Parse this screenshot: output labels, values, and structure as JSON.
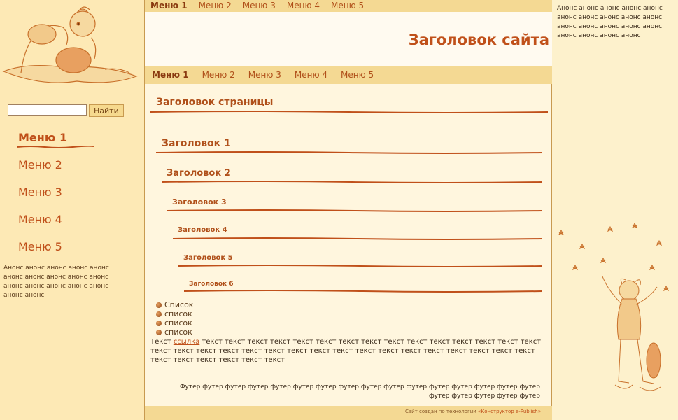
{
  "top_nav": [
    "Меню 1",
    "Меню 2",
    "Меню 3",
    "Меню 4",
    "Меню 5"
  ],
  "mid_nav": [
    "Меню 1",
    "Меню 2",
    "Меню 3",
    "Меню 4",
    "Меню 5"
  ],
  "site_title": "Заголовок сайта",
  "search": {
    "button": "Найти",
    "value": ""
  },
  "side_menu": [
    "Меню 1",
    "Меню 2",
    "Меню 3",
    "Меню 4",
    "Меню 5"
  ],
  "left_announce": "Анонс анонс анонс анонс анонс анонс анонс анонс анонс анонс анонс анонс анонс анонс анонс анонс анонс",
  "right_announce": "Анонс анонс анонс анонс анонс анонс анонс анонс анонс анонс анонс анонс анонс анонс анонс анонс анонс анонс анонс",
  "page_title": "Заголовок страницы",
  "headings": [
    "Заголовок 1",
    "Заголовок 2",
    "Заголовок 3",
    "Заголовок 4",
    "Заголовок 5",
    "Заголовок 6"
  ],
  "list": [
    "Список",
    "список",
    "список",
    "список"
  ],
  "body": {
    "text_before": "Текст",
    "link": "ссылка",
    "text_after": "текст текст текст текст текст текст текст текст текст текст текст текст текст текст текст текст текст текст текст текст текст текст текст текст текст текст текст текст текст текст текст текст текст текст текст текст текст текст"
  },
  "footer": "Футер футер футер футер футер футер футер футер футер футер футер футер футер футер футер футер футер футер футер футер футер",
  "credit": {
    "text": "Сайт создан по технологии",
    "link": "«Конструктор e-Publish»"
  },
  "colors": {
    "accent": "#c0501a",
    "bar": "#f4d993",
    "background": "#fff6de"
  }
}
